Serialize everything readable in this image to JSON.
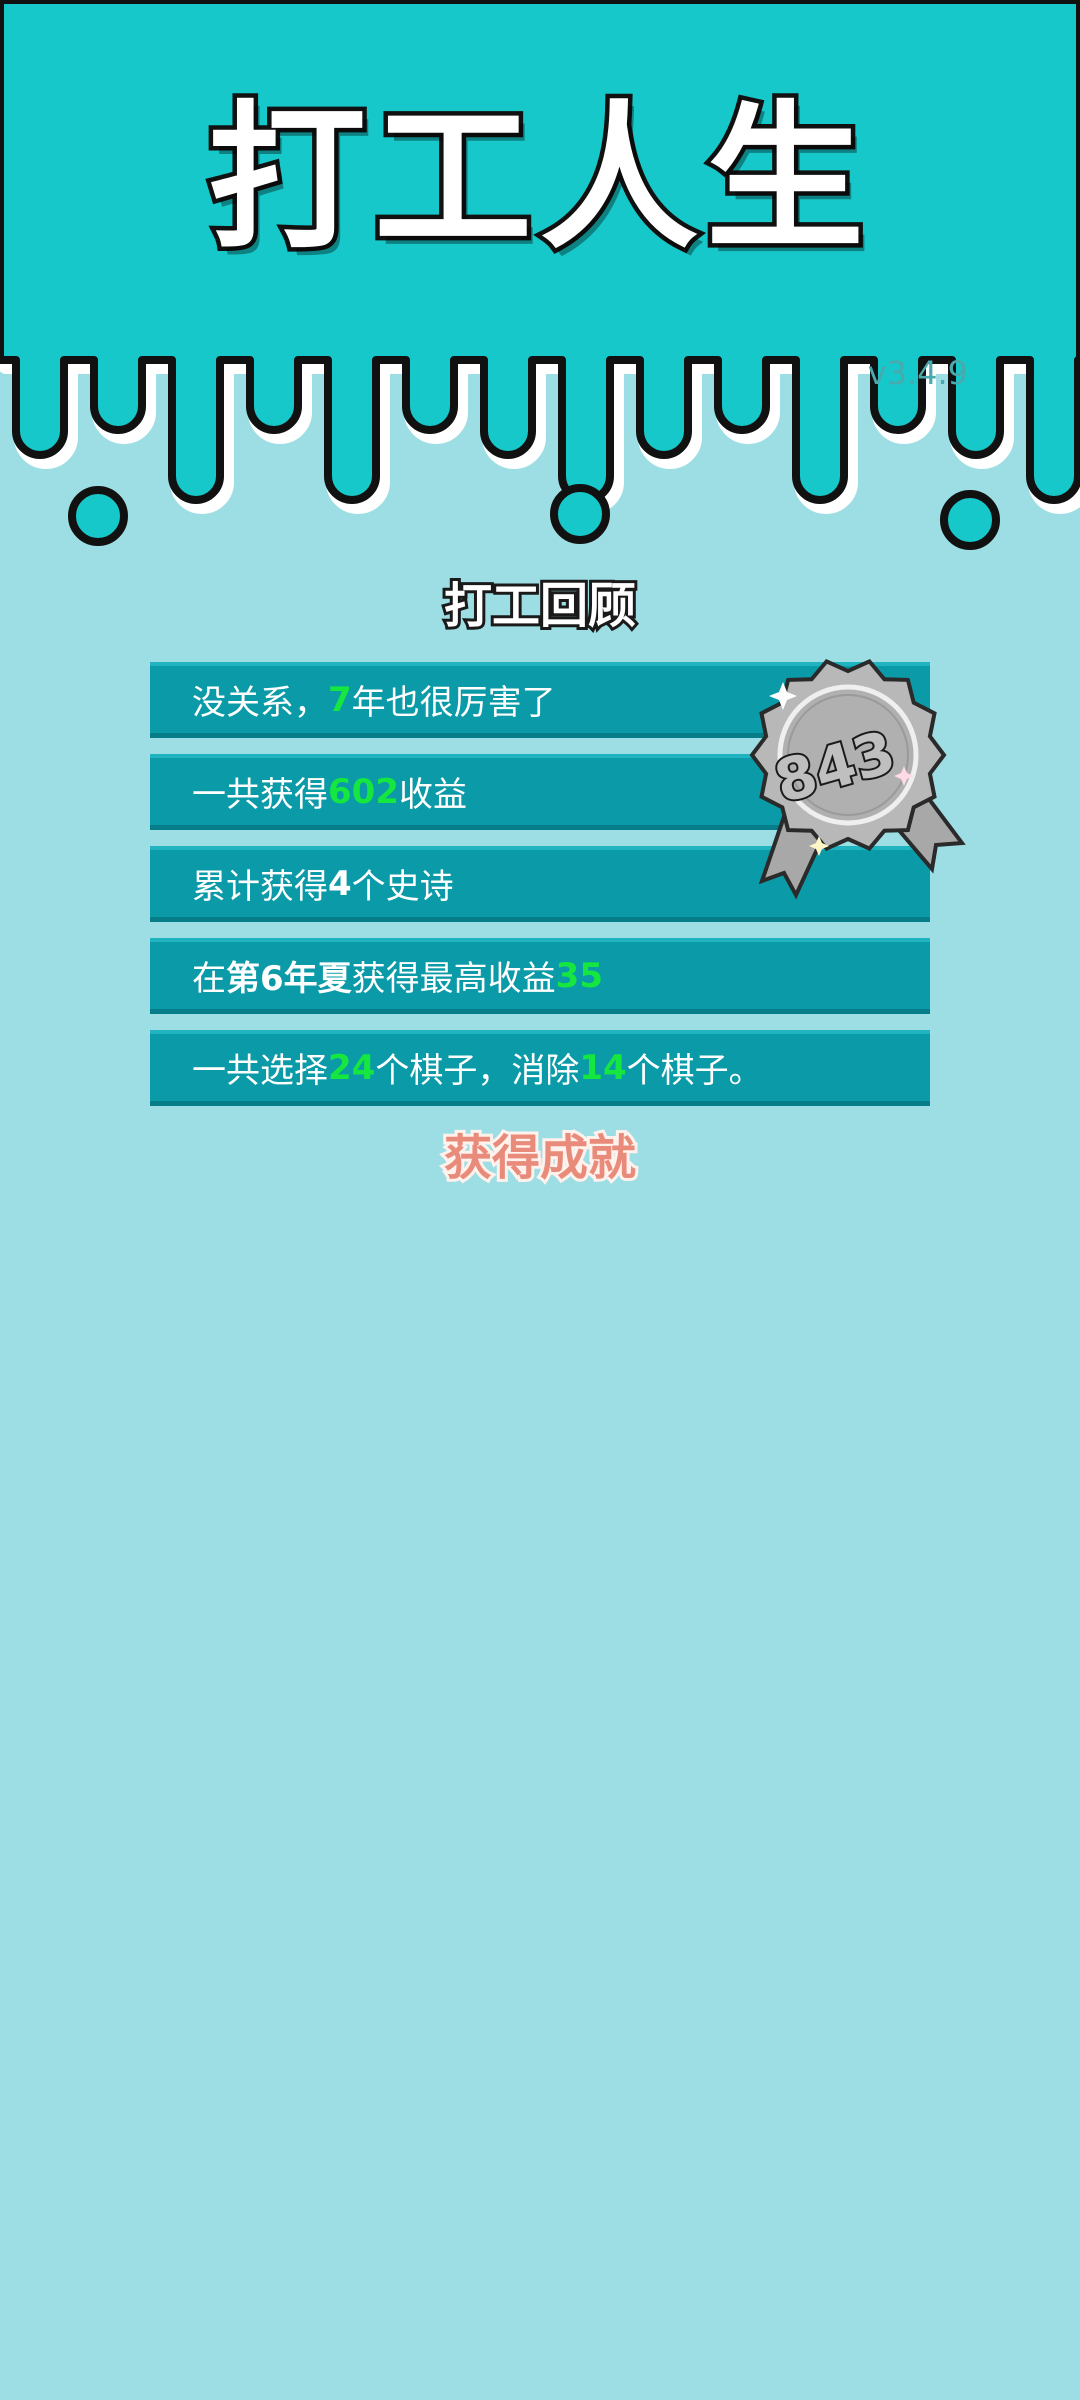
{
  "app": {
    "title": "打工人生",
    "version": "v3.4.9"
  },
  "review": {
    "heading": "打工回顾",
    "rows": [
      {
        "segments": [
          {
            "text": "没关系，"
          },
          {
            "text": "7",
            "hl": true
          },
          {
            "text": "年也很厉害了"
          }
        ]
      },
      {
        "segments": [
          {
            "text": "一共获得"
          },
          {
            "text": "602",
            "hl": true
          },
          {
            "text": "收益"
          }
        ]
      },
      {
        "segments": [
          {
            "text": "累计获得"
          },
          {
            "text": "4",
            "bold": true
          },
          {
            "text": "个史诗"
          }
        ]
      },
      {
        "segments": [
          {
            "text": "在 "
          },
          {
            "text": "第6年夏",
            "bold": true
          },
          {
            "text": " 获得最高收益"
          },
          {
            "text": "35",
            "hl": true
          }
        ]
      },
      {
        "segments": [
          {
            "text": "一共选择"
          },
          {
            "text": "24",
            "hl": true
          },
          {
            "text": "个棋子，消除"
          },
          {
            "text": "14",
            "hl": true
          },
          {
            "text": "个棋子。"
          }
        ]
      }
    ]
  },
  "badge": {
    "score": "843",
    "icon": "silver-rosette-icon"
  },
  "achievements": {
    "heading": "获得成就"
  },
  "colors": {
    "header_bg": "#16c8ca",
    "page_bg": "#9ddee4",
    "row_bg": "#0b9aa7",
    "highlight": "#16e640",
    "achievement_heading": "#e98b7b"
  }
}
